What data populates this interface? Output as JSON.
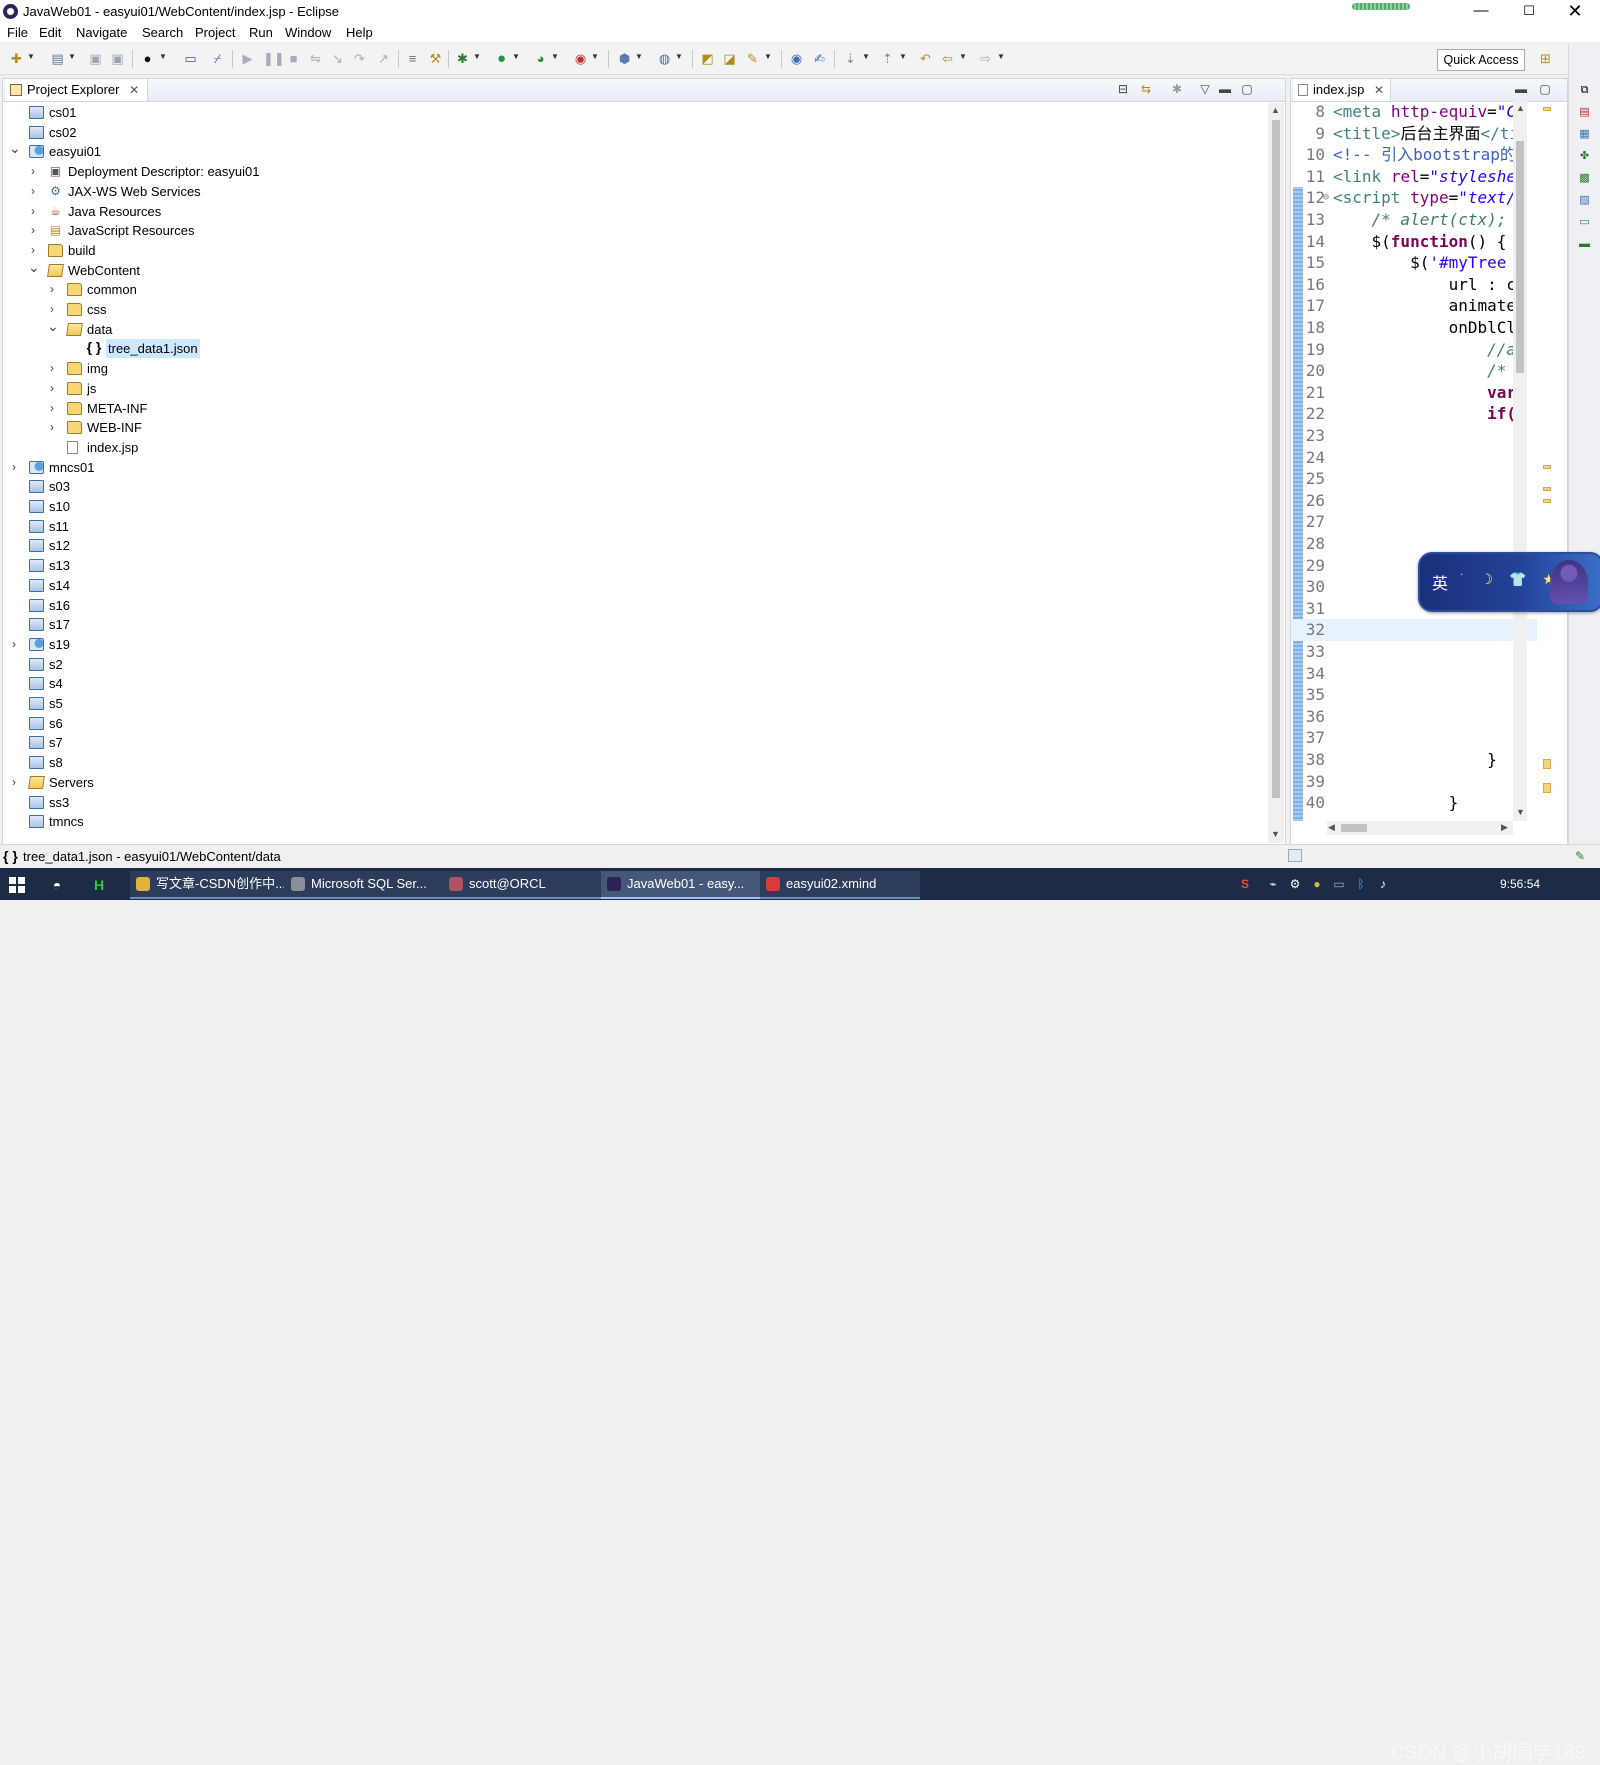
{
  "window": {
    "title": "JavaWeb01 - easyui01/WebContent/index.jsp - Eclipse",
    "controls": {
      "minimize": "—",
      "maximize": "☐",
      "close": "✕"
    }
  },
  "menu": [
    "File",
    "Edit",
    "Navigate",
    "Search",
    "Project",
    "Run",
    "Window",
    "Help"
  ],
  "toolbar": {
    "quick_access": "Quick Access"
  },
  "project_explorer": {
    "tab_label": "Project Explorer",
    "tree": [
      {
        "label": "cs01",
        "icon": "project-folder-icon",
        "twisty": ""
      },
      {
        "label": "cs02",
        "icon": "project-folder-icon",
        "twisty": ""
      },
      {
        "label": "easyui01",
        "icon": "web-project-icon",
        "twisty": "expanded"
      },
      {
        "label": "Deployment Descriptor: easyui01",
        "icon": "deployment-descriptor-icon",
        "twisty": "collapsed"
      },
      {
        "label": "JAX-WS Web Services",
        "icon": "web-services-icon",
        "twisty": "collapsed"
      },
      {
        "label": "Java Resources",
        "icon": "java-resources-icon",
        "twisty": "collapsed"
      },
      {
        "label": "JavaScript Resources",
        "icon": "javascript-resources-icon",
        "twisty": "collapsed"
      },
      {
        "label": "build",
        "icon": "folder-icon",
        "twisty": "collapsed"
      },
      {
        "label": "WebContent",
        "icon": "folder-open-icon",
        "twisty": "expanded"
      },
      {
        "label": "common",
        "icon": "folder-icon",
        "twisty": "collapsed"
      },
      {
        "label": "css",
        "icon": "folder-icon",
        "twisty": "collapsed"
      },
      {
        "label": "data",
        "icon": "folder-open-icon",
        "twisty": "expanded"
      },
      {
        "label": "tree_data1.json",
        "icon": "json-file-icon",
        "twisty": "",
        "selected": true
      },
      {
        "label": "img",
        "icon": "folder-icon",
        "twisty": "collapsed"
      },
      {
        "label": "js",
        "icon": "folder-icon",
        "twisty": "collapsed"
      },
      {
        "label": "META-INF",
        "icon": "folder-icon",
        "twisty": "collapsed"
      },
      {
        "label": "WEB-INF",
        "icon": "folder-icon",
        "twisty": "collapsed"
      },
      {
        "label": "index.jsp",
        "icon": "jsp-file-icon",
        "twisty": ""
      },
      {
        "label": "mncs01",
        "icon": "web-project-icon",
        "twisty": "collapsed"
      },
      {
        "label": "s03",
        "icon": "project-folder-icon",
        "twisty": ""
      },
      {
        "label": "s10",
        "icon": "project-folder-icon",
        "twisty": ""
      },
      {
        "label": "s11",
        "icon": "project-folder-icon",
        "twisty": ""
      },
      {
        "label": "s12",
        "icon": "project-folder-icon",
        "twisty": ""
      },
      {
        "label": "s13",
        "icon": "project-folder-icon",
        "twisty": ""
      },
      {
        "label": "s14",
        "icon": "project-folder-icon",
        "twisty": ""
      },
      {
        "label": "s16",
        "icon": "project-folder-icon",
        "twisty": ""
      },
      {
        "label": "s17",
        "icon": "project-folder-icon",
        "twisty": ""
      },
      {
        "label": "s19",
        "icon": "web-project-icon",
        "twisty": "collapsed"
      },
      {
        "label": "s2",
        "icon": "project-folder-icon",
        "twisty": ""
      },
      {
        "label": "s4",
        "icon": "project-folder-icon",
        "twisty": ""
      },
      {
        "label": "s5",
        "icon": "project-folder-icon",
        "twisty": ""
      },
      {
        "label": "s6",
        "icon": "project-folder-icon",
        "twisty": ""
      },
      {
        "label": "s7",
        "icon": "project-folder-icon",
        "twisty": ""
      },
      {
        "label": "s8",
        "icon": "project-folder-icon",
        "twisty": ""
      },
      {
        "label": "Servers",
        "icon": "folder-open-icon",
        "twisty": "collapsed"
      },
      {
        "label": "ss3",
        "icon": "project-folder-icon",
        "twisty": ""
      },
      {
        "label": "tmncs",
        "icon": "project-folder-icon",
        "twisty": ""
      }
    ]
  },
  "editor": {
    "tab_label": "index.jsp",
    "current_line": 32,
    "lines": [
      {
        "no": "8",
        "html": "<span class=\"c-tag\">&lt;meta</span> <span class=\"c-attr\">http-equiv</span>=<span class=\"c-str\">\"C</span>"
      },
      {
        "no": "9",
        "html": "<span class=\"c-tag\">&lt;title&gt;</span>后台主界面<span class=\"c-tag\">&lt;/ti</span>"
      },
      {
        "no": "10",
        "html": "<span class=\"c-com\">&lt;!-- 引入bootstrap的</span>"
      },
      {
        "no": "11",
        "html": "<span class=\"c-tag\">&lt;link</span> <span class=\"c-attr\">rel</span>=<span class=\"c-str\">\"styleshe</span>"
      },
      {
        "no": "12",
        "html": "<span class=\"c-tag\">&lt;script</span> <span class=\"c-attr\">type</span>=<span class=\"c-str\">\"text/</span>"
      },
      {
        "no": "13",
        "html": "    <span class=\"c-jscom\">/* alert(ctx);</span>"
      },
      {
        "no": "14",
        "html": "    $(<span class=\"c-kw\">function</span>() {"
      },
      {
        "no": "15",
        "html": "        $(<span class=\"c-str\" style=\"font-style:normal\">'#myTree</span>"
      },
      {
        "no": "16",
        "html": "            url : c"
      },
      {
        "no": "17",
        "html": "            animate"
      },
      {
        "no": "18",
        "html": "            onDblCl"
      },
      {
        "no": "19",
        "html": "                <span class=\"c-jscom\">//a</span>"
      },
      {
        "no": "20",
        "html": "                <span class=\"c-jscom\">/*</span>"
      },
      {
        "no": "21",
        "html": "                <span class=\"c-kw\">var</span>"
      },
      {
        "no": "22",
        "html": "                <span class=\"c-kw\">if(</span>"
      },
      {
        "no": "23",
        "html": ""
      },
      {
        "no": "24",
        "html": ""
      },
      {
        "no": "25",
        "html": ""
      },
      {
        "no": "26",
        "html": ""
      },
      {
        "no": "27",
        "html": ""
      },
      {
        "no": "28",
        "html": ""
      },
      {
        "no": "29",
        "html": ""
      },
      {
        "no": "30",
        "html": ""
      },
      {
        "no": "31",
        "html": ""
      },
      {
        "no": "32",
        "html": ""
      },
      {
        "no": "33",
        "html": ""
      },
      {
        "no": "34",
        "html": ""
      },
      {
        "no": "35",
        "html": ""
      },
      {
        "no": "36",
        "html": ""
      },
      {
        "no": "37",
        "html": ""
      },
      {
        "no": "38",
        "html": "                }"
      },
      {
        "no": "39",
        "html": ""
      },
      {
        "no": "40",
        "html": "            }"
      }
    ]
  },
  "ime": {
    "lang": "英",
    "icons": "˙ ☽ 👕 ★"
  },
  "status": {
    "selected_path": "tree_data1.json - easyui01/WebContent/data",
    "icon": "{ }"
  },
  "taskbar": {
    "apps": [
      {
        "label": "写文章-CSDN创作中...",
        "icon_color": "#e0b33a"
      },
      {
        "label": "Microsoft SQL Ser...",
        "icon_color": "#8a8f99"
      },
      {
        "label": "scott@ORCL",
        "icon_color": "#b05060"
      },
      {
        "label": "JavaWeb01 - easy...",
        "icon_color": "#2c2255",
        "active": true
      },
      {
        "label": "easyui02.xmind",
        "icon_color": "#d93a3a"
      }
    ],
    "clock": "9:56:54",
    "watermark": "CSDN @小胡同学189"
  },
  "colors": {
    "accent": "#cce8ff",
    "taskbar": "#1c2c44",
    "gutter_change": "#7fb0e3"
  }
}
